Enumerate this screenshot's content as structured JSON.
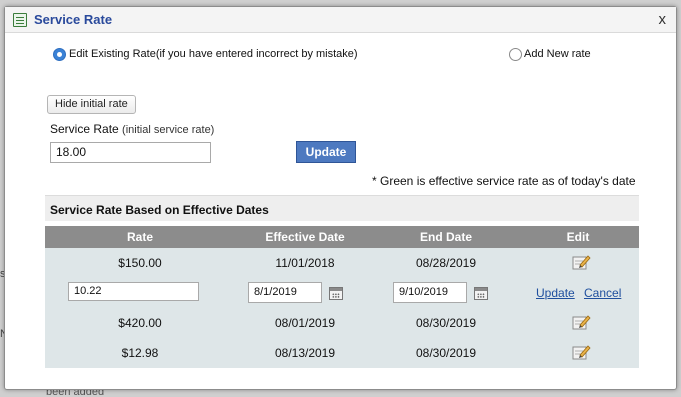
{
  "background": {
    "fragment_bottom": "been added",
    "edge_char_1": "s",
    "edge_char_2": "N"
  },
  "dialog": {
    "title": "Service Rate",
    "title_icon": "form-icon",
    "close_label": "x"
  },
  "mode": {
    "options": [
      {
        "label": "Edit Existing Rate(if you have entered incorrect by mistake)",
        "selected": true
      },
      {
        "label": "Add New rate",
        "selected": false
      }
    ]
  },
  "initial_rate": {
    "toggle_button_label": "Hide initial rate",
    "label": "Service Rate",
    "label_hint": "(initial service rate)",
    "value": "18.00",
    "update_button_label": "Update"
  },
  "note": "* Green is effective service rate as of today's date",
  "rates_table": {
    "section_title": "Service Rate Based on Effective Dates",
    "columns": [
      "Rate",
      "Effective Date",
      "End Date",
      "Edit"
    ],
    "rows": [
      {
        "rate": "$150.00",
        "effective_date": "11/01/2018",
        "end_date": "08/28/2019",
        "edit_icon": "edit-icon"
      },
      {
        "editing": true,
        "rate_value": "10.22",
        "effective_date_value": "8/1/2019",
        "end_date_value": "9/10/2019",
        "update_label": "Update",
        "cancel_label": "Cancel",
        "calendar_icon": "calendar-icon"
      },
      {
        "rate": "$420.00",
        "effective_date": "08/01/2019",
        "end_date": "08/30/2019",
        "edit_icon": "edit-icon"
      },
      {
        "rate": "$12.98",
        "effective_date": "08/13/2019",
        "end_date": "08/30/2019",
        "edit_icon": "edit-icon"
      }
    ]
  },
  "colors": {
    "title_text": "#2a4a9c",
    "update_button": "#4d79c0",
    "table_header": "#8c8c8c",
    "table_body": "#dee6e8",
    "link": "#1f4f9e",
    "radio_selected": "#3b82d6"
  }
}
